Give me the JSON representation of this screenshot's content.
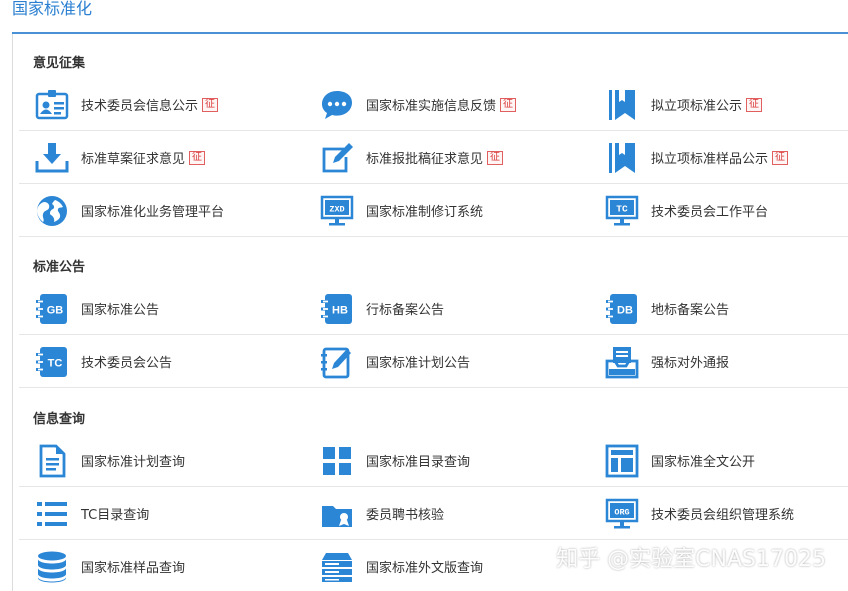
{
  "page": {
    "title": "国家标准化"
  },
  "colors": {
    "accent": "#2a7fd1",
    "icon": "#2b86d6",
    "badge": "#d83a3a"
  },
  "sections": [
    {
      "title": "意见征集",
      "rows": [
        [
          {
            "label": "技术委员会信息公示",
            "badge": "征",
            "icon": "id-card-icon"
          },
          {
            "label": "国家标准实施信息反馈",
            "badge": "征",
            "icon": "chat-bubble-icon"
          },
          {
            "label": "拟立项标准公示",
            "badge": "征",
            "icon": "bookmark-icon"
          }
        ],
        [
          {
            "label": "标准草案征求意见",
            "badge": "征",
            "icon": "download-icon"
          },
          {
            "label": "标准报批稿征求意见",
            "badge": "征",
            "icon": "edit-icon"
          },
          {
            "label": "拟立项标准样品公示",
            "badge": "征",
            "icon": "bookmark-icon"
          }
        ],
        [
          {
            "label": "国家标准化业务管理平台",
            "badge": "",
            "icon": "globe-icon"
          },
          {
            "label": "国家标准制修订系统",
            "badge": "",
            "icon": "monitor-zxd-icon",
            "icon_text": "ZXD"
          },
          {
            "label": "技术委员会工作平台",
            "badge": "",
            "icon": "monitor-tc-icon",
            "icon_text": "TC"
          }
        ]
      ]
    },
    {
      "title": "标准公告",
      "rows": [
        [
          {
            "label": "国家标准公告",
            "badge": "",
            "icon": "gb-notebook-icon",
            "icon_text": "GB"
          },
          {
            "label": "行标备案公告",
            "badge": "",
            "icon": "hb-notebook-icon",
            "icon_text": "HB"
          },
          {
            "label": "地标备案公告",
            "badge": "",
            "icon": "db-notebook-icon",
            "icon_text": "DB"
          }
        ],
        [
          {
            "label": "技术委员会公告",
            "badge": "",
            "icon": "tc-notebook-icon",
            "icon_text": "TC"
          },
          {
            "label": "国家标准计划公告",
            "badge": "",
            "icon": "notebook-pen-icon"
          },
          {
            "label": "强标对外通报",
            "badge": "",
            "icon": "inbox-icon"
          }
        ]
      ]
    },
    {
      "title": "信息查询",
      "rows": [
        [
          {
            "label": "国家标准计划查询",
            "badge": "",
            "icon": "document-icon"
          },
          {
            "label": "国家标准目录查询",
            "badge": "",
            "icon": "grid-icon"
          },
          {
            "label": "国家标准全文公开",
            "badge": "",
            "icon": "layout-icon"
          }
        ],
        [
          {
            "label": "TC目录查询",
            "badge": "",
            "icon": "list-icon"
          },
          {
            "label": "委员聘书核验",
            "badge": "",
            "icon": "folder-icon"
          },
          {
            "label": "技术委员会组织管理系统",
            "badge": "",
            "icon": "monitor-org-icon",
            "icon_text": "ORG"
          }
        ],
        [
          {
            "label": "国家标准样品查询",
            "badge": "",
            "icon": "database-icon"
          },
          {
            "label": "国家标准外文版查询",
            "badge": "",
            "icon": "server-icon"
          },
          {
            "label": "",
            "badge": "",
            "icon": ""
          }
        ]
      ]
    }
  ],
  "watermark": "知乎 @实验室CNAS17025"
}
